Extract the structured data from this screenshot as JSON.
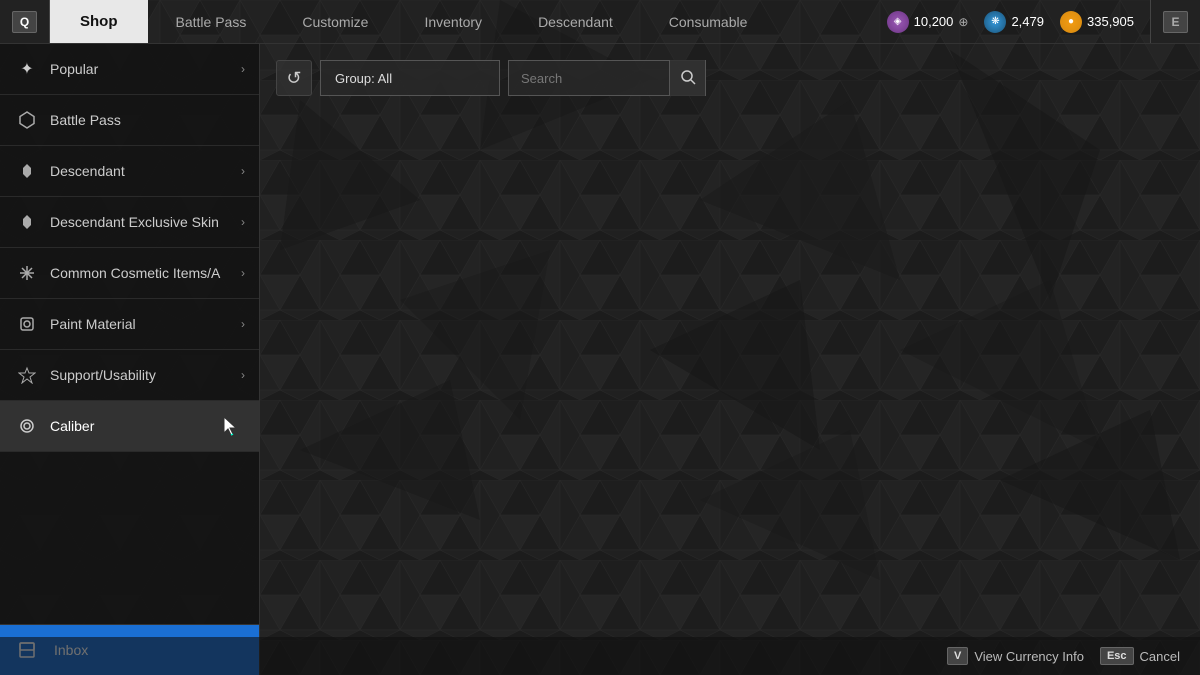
{
  "nav": {
    "icon_left": "Q",
    "shop_label": "Shop",
    "items": [
      {
        "label": "Battle Pass",
        "id": "battle-pass"
      },
      {
        "label": "Customize",
        "id": "customize"
      },
      {
        "label": "Inventory",
        "id": "inventory"
      },
      {
        "label": "Descendant",
        "id": "descendant"
      },
      {
        "label": "Consumable",
        "id": "consumable"
      }
    ],
    "icon_right": "E"
  },
  "currency": [
    {
      "id": "purple",
      "amount": "10,200",
      "color_class": "ci-purple",
      "has_plus": true
    },
    {
      "id": "blue",
      "amount": "2,479",
      "color_class": "ci-blue",
      "has_plus": false
    },
    {
      "id": "gold",
      "amount": "335,905",
      "color_class": "ci-gold",
      "has_plus": false
    }
  ],
  "sidebar": {
    "items": [
      {
        "label": "Popular",
        "icon": "✦",
        "has_arrow": true,
        "active": false,
        "id": "popular"
      },
      {
        "label": "Battle Pass",
        "icon": "⬡",
        "has_arrow": false,
        "active": false,
        "id": "battle-pass"
      },
      {
        "label": "Descendant",
        "icon": "✿",
        "has_arrow": true,
        "active": false,
        "id": "descendant"
      },
      {
        "label": "Descendant Exclusive Skin",
        "icon": "✿",
        "has_arrow": true,
        "active": false,
        "id": "descendant-exclusive"
      },
      {
        "label": "Common Cosmetic Items/A",
        "icon": "✦",
        "has_arrow": true,
        "active": false,
        "id": "common-cosmetic"
      },
      {
        "label": "Paint Material",
        "icon": "◈",
        "has_arrow": true,
        "active": false,
        "id": "paint-material"
      },
      {
        "label": "Support/Usability",
        "icon": "✦",
        "has_arrow": true,
        "active": false,
        "id": "support-usability"
      },
      {
        "label": "Caliber",
        "icon": "◎",
        "has_arrow": false,
        "active": true,
        "id": "caliber"
      }
    ],
    "inbox_label": "Inbox",
    "inbox_icon": "▣"
  },
  "filter": {
    "group_label": "Group: All",
    "search_placeholder": "Search",
    "refresh_icon": "↺",
    "search_icon": "🔍"
  },
  "bottom": {
    "view_currency_key": "V",
    "view_currency_label": "View Currency Info",
    "cancel_key": "Esc",
    "cancel_label": "Cancel"
  }
}
